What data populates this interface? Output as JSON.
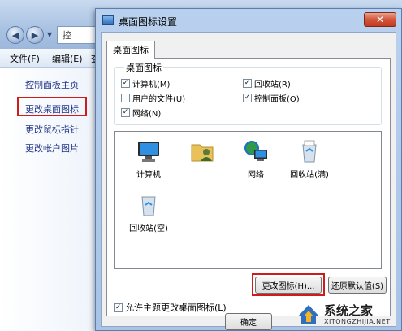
{
  "background_window": {
    "address_text": "控",
    "menu": [
      "文件(F)",
      "编辑(E)",
      "查"
    ],
    "side_links": [
      "控制面板主页",
      "更改桌面图标",
      "更改鼠标指针",
      "更改帐户图片"
    ],
    "highlighted_link_index": 1
  },
  "dialog": {
    "title": "桌面图标设置",
    "close_label": "✕",
    "tab_label": "桌面图标",
    "group_label": "桌面图标",
    "checkboxes": [
      {
        "label": "计算机(M)",
        "checked": true
      },
      {
        "label": "回收站(R)",
        "checked": true
      },
      {
        "label": "用户的文件(U)",
        "checked": false
      },
      {
        "label": "控制面板(O)",
        "checked": true
      },
      {
        "label": "网络(N)",
        "checked": true
      }
    ],
    "icons": [
      {
        "label": "计算机",
        "icon": "computer-icon"
      },
      {
        "label": "",
        "icon": "user-files-icon"
      },
      {
        "label": "网络",
        "icon": "network-icon"
      },
      {
        "label": "回收站(满)",
        "icon": "recycle-bin-full-icon"
      },
      {
        "label": "回收站(空)",
        "icon": "recycle-bin-empty-icon"
      }
    ],
    "change_icon_button": "更改图标(H)...",
    "restore_default_button": "还原默认值(S)",
    "allow_themes_checkbox": {
      "label": "允许主题更改桌面图标(L)",
      "checked": true
    },
    "ok_button": "确定"
  },
  "watermark": {
    "title": "系统之家",
    "url": "XITONGZHIJIA.NET"
  },
  "colors": {
    "highlight_red": "#d11a1a",
    "link_blue": "#1e3287"
  }
}
